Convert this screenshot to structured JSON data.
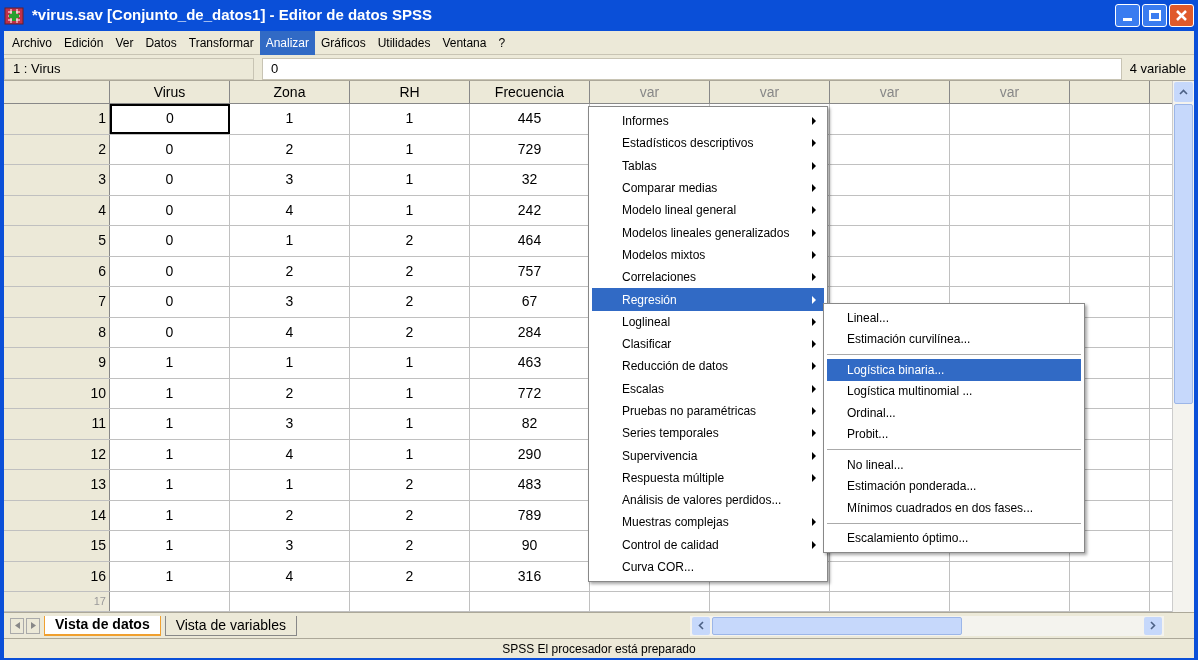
{
  "window": {
    "title": "*virus.sav [Conjunto_de_datos1] - Editor de datos SPSS"
  },
  "menubar": [
    {
      "label": "Archivo",
      "selected": false
    },
    {
      "label": "Edición",
      "selected": false
    },
    {
      "label": "Ver",
      "selected": false
    },
    {
      "label": "Datos",
      "selected": false
    },
    {
      "label": "Transformar",
      "selected": false
    },
    {
      "label": "Analizar",
      "selected": true
    },
    {
      "label": "Gráficos",
      "selected": false
    },
    {
      "label": "Utilidades",
      "selected": false
    },
    {
      "label": "Ventana",
      "selected": false
    },
    {
      "label": "?",
      "selected": false
    }
  ],
  "cell_editor": {
    "cell_name": "1 : Virus",
    "value": "0",
    "variable_count": "4 variable"
  },
  "table": {
    "columns": [
      "Virus",
      "Zona",
      "RH",
      "Frecuencia",
      "var",
      "var",
      "var",
      "var"
    ],
    "rows": [
      {
        "header": "1",
        "cells": [
          {
            "value": "0",
            "selected": true
          },
          {
            "value": "1",
            "selected": false
          },
          {
            "value": "1",
            "selected": false
          },
          {
            "value": "445",
            "selected": false
          }
        ]
      },
      {
        "header": "2",
        "cells": [
          {
            "value": "0",
            "selected": false
          },
          {
            "value": "2",
            "selected": false
          },
          {
            "value": "1",
            "selected": false
          },
          {
            "value": "729",
            "selected": false
          }
        ]
      },
      {
        "header": "3",
        "cells": [
          {
            "value": "0",
            "selected": false
          },
          {
            "value": "3",
            "selected": false
          },
          {
            "value": "1",
            "selected": false
          },
          {
            "value": "32",
            "selected": false
          }
        ]
      },
      {
        "header": "4",
        "cells": [
          {
            "value": "0",
            "selected": false
          },
          {
            "value": "4",
            "selected": false
          },
          {
            "value": "1",
            "selected": false
          },
          {
            "value": "242",
            "selected": false
          }
        ]
      },
      {
        "header": "5",
        "cells": [
          {
            "value": "0",
            "selected": false
          },
          {
            "value": "1",
            "selected": false
          },
          {
            "value": "2",
            "selected": false
          },
          {
            "value": "464",
            "selected": false
          }
        ]
      },
      {
        "header": "6",
        "cells": [
          {
            "value": "0",
            "selected": false
          },
          {
            "value": "2",
            "selected": false
          },
          {
            "value": "2",
            "selected": false
          },
          {
            "value": "757",
            "selected": false
          }
        ]
      },
      {
        "header": "7",
        "cells": [
          {
            "value": "0",
            "selected": false
          },
          {
            "value": "3",
            "selected": false
          },
          {
            "value": "2",
            "selected": false
          },
          {
            "value": "67",
            "selected": false
          }
        ]
      },
      {
        "header": "8",
        "cells": [
          {
            "value": "0",
            "selected": false
          },
          {
            "value": "4",
            "selected": false
          },
          {
            "value": "2",
            "selected": false
          },
          {
            "value": "284",
            "selected": false
          }
        ]
      },
      {
        "header": "9",
        "cells": [
          {
            "value": "1",
            "selected": false
          },
          {
            "value": "1",
            "selected": false
          },
          {
            "value": "1",
            "selected": false
          },
          {
            "value": "463",
            "selected": false
          }
        ]
      },
      {
        "header": "10",
        "cells": [
          {
            "value": "1",
            "selected": false
          },
          {
            "value": "2",
            "selected": false
          },
          {
            "value": "1",
            "selected": false
          },
          {
            "value": "772",
            "selected": false
          }
        ]
      },
      {
        "header": "11",
        "cells": [
          {
            "value": "1",
            "selected": false
          },
          {
            "value": "3",
            "selected": false
          },
          {
            "value": "1",
            "selected": false
          },
          {
            "value": "82",
            "selected": false
          }
        ]
      },
      {
        "header": "12",
        "cells": [
          {
            "value": "1",
            "selected": false
          },
          {
            "value": "4",
            "selected": false
          },
          {
            "value": "1",
            "selected": false
          },
          {
            "value": "290",
            "selected": false
          }
        ]
      },
      {
        "header": "13",
        "cells": [
          {
            "value": "1",
            "selected": false
          },
          {
            "value": "1",
            "selected": false
          },
          {
            "value": "2",
            "selected": false
          },
          {
            "value": "483",
            "selected": false
          }
        ]
      },
      {
        "header": "14",
        "cells": [
          {
            "value": "1",
            "selected": false
          },
          {
            "value": "2",
            "selected": false
          },
          {
            "value": "2",
            "selected": false
          },
          {
            "value": "789",
            "selected": false
          }
        ]
      },
      {
        "header": "15",
        "cells": [
          {
            "value": "1",
            "selected": false
          },
          {
            "value": "3",
            "selected": false
          },
          {
            "value": "2",
            "selected": false
          },
          {
            "value": "90",
            "selected": false
          }
        ]
      },
      {
        "header": "16",
        "cells": [
          {
            "value": "1",
            "selected": false
          },
          {
            "value": "4",
            "selected": false
          },
          {
            "value": "2",
            "selected": false
          },
          {
            "value": "316",
            "selected": false
          }
        ]
      },
      {
        "header": "17",
        "cells": []
      }
    ]
  },
  "analyze_menu": [
    {
      "label": "Informes",
      "submenu": true,
      "selected": false
    },
    {
      "label": "Estadísticos descriptivos",
      "submenu": true,
      "selected": false
    },
    {
      "label": "Tablas",
      "submenu": true,
      "selected": false
    },
    {
      "label": "Comparar medias",
      "submenu": true,
      "selected": false
    },
    {
      "label": "Modelo lineal general",
      "submenu": true,
      "selected": false
    },
    {
      "label": "Modelos lineales generalizados",
      "submenu": true,
      "selected": false
    },
    {
      "label": "Modelos mixtos",
      "submenu": true,
      "selected": false
    },
    {
      "label": "Correlaciones",
      "submenu": true,
      "selected": false
    },
    {
      "label": "Regresión",
      "submenu": true,
      "selected": true
    },
    {
      "label": "Loglineal",
      "submenu": true,
      "selected": false
    },
    {
      "label": "Clasificar",
      "submenu": true,
      "selected": false
    },
    {
      "label": "Reducción de datos",
      "submenu": true,
      "selected": false
    },
    {
      "label": "Escalas",
      "submenu": true,
      "selected": false
    },
    {
      "label": "Pruebas no paramétricas",
      "submenu": true,
      "selected": false
    },
    {
      "label": "Series temporales",
      "submenu": true,
      "selected": false
    },
    {
      "label": "Supervivencia",
      "submenu": true,
      "selected": false
    },
    {
      "label": "Respuesta múltiple",
      "submenu": true,
      "selected": false
    },
    {
      "label": "Análisis de valores perdidos...",
      "submenu": false,
      "selected": false
    },
    {
      "label": "Muestras complejas",
      "submenu": true,
      "selected": false
    },
    {
      "label": "Control de calidad",
      "submenu": true,
      "selected": false
    },
    {
      "label": "Curva COR...",
      "submenu": false,
      "selected": false
    }
  ],
  "regression_submenu": [
    [
      {
        "label": "Lineal...",
        "selected": false
      },
      {
        "label": "Estimación curvilínea...",
        "selected": false
      }
    ],
    [
      {
        "label": "Logística binaria...",
        "selected": true
      },
      {
        "label": "Logística multinomial ...",
        "selected": false
      },
      {
        "label": "Ordinal...",
        "selected": false
      },
      {
        "label": "Probit...",
        "selected": false
      }
    ],
    [
      {
        "label": "No lineal...",
        "selected": false
      },
      {
        "label": "Estimación ponderada...",
        "selected": false
      },
      {
        "label": "Mínimos cuadrados en dos fases...",
        "selected": false
      }
    ],
    [
      {
        "label": "Escalamiento óptimo...",
        "selected": false
      }
    ]
  ],
  "sheet_tabs": [
    {
      "label": "Vista de datos",
      "selected": true
    },
    {
      "label": "Vista de variables",
      "selected": false
    }
  ],
  "status_bar": "SPSS El procesador está preparado"
}
